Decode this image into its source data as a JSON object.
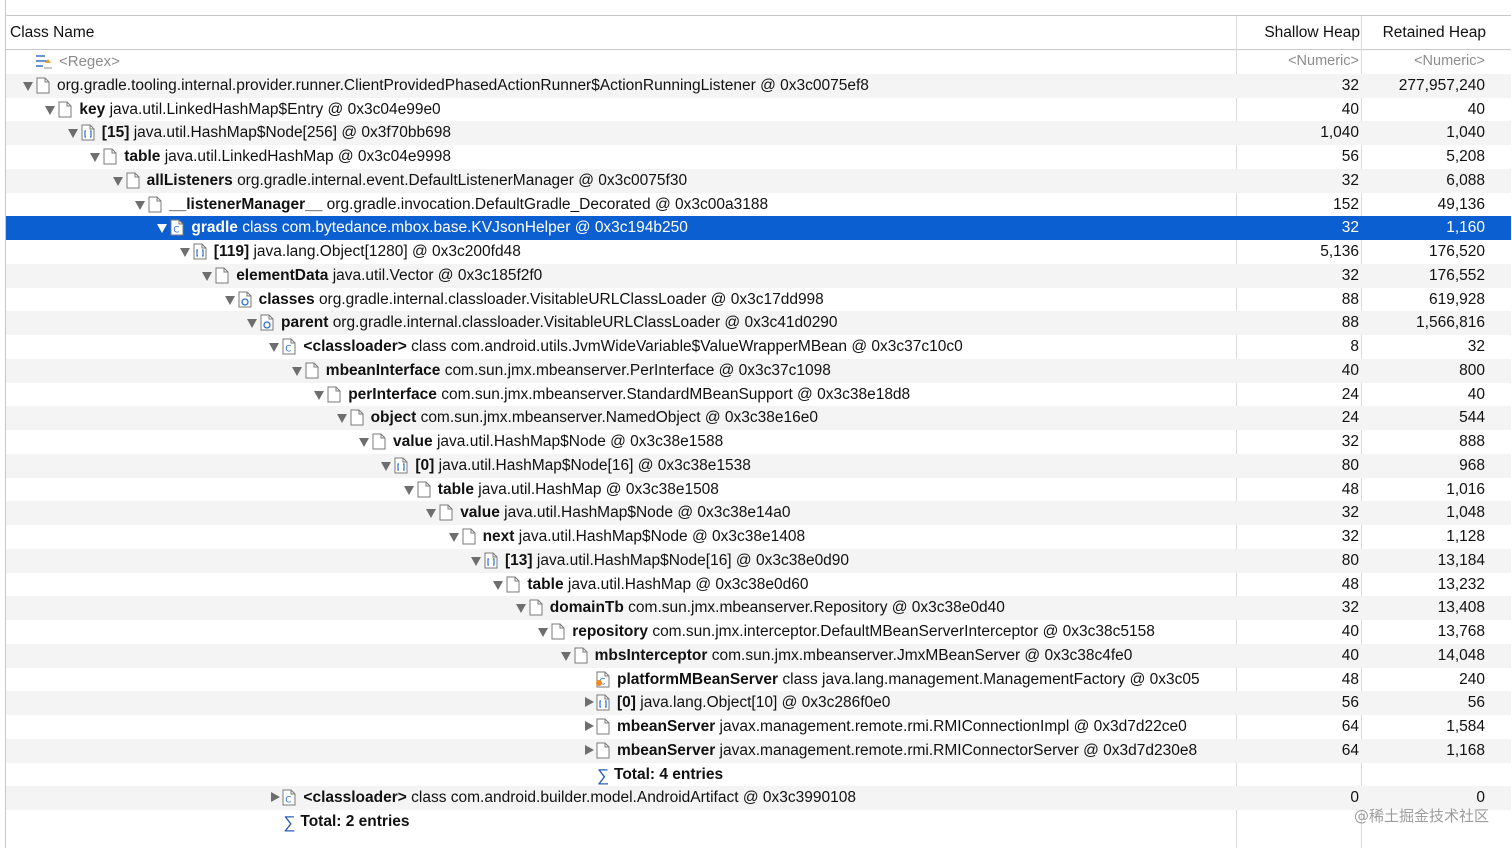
{
  "columns": {
    "class_name": "Class Name",
    "shallow_heap": "Shallow Heap",
    "retained_heap": "Retained Heap"
  },
  "filter": {
    "regex": "<Regex>",
    "shallow_numeric": "<Numeric>",
    "retained_numeric": "<Numeric>"
  },
  "rows": [
    {
      "indent": 0,
      "toggle": "open",
      "icon": "page",
      "bold": "",
      "text": "org.gradle.tooling.internal.provider.runner.ClientProvidedPhasedActionRunner$ActionRunningListener @ 0x3c0075ef8",
      "shallow": "32",
      "retained": "277,957,240"
    },
    {
      "indent": 1,
      "toggle": "open",
      "icon": "page",
      "bold": "key",
      "text": "java.util.LinkedHashMap$Entry @ 0x3c04e99e0",
      "shallow": "40",
      "retained": "40"
    },
    {
      "indent": 2,
      "toggle": "open",
      "icon": "array",
      "bold": "[15]",
      "text": "java.util.HashMap$Node[256] @ 0x3f70bb698",
      "shallow": "1,040",
      "retained": "1,040"
    },
    {
      "indent": 3,
      "toggle": "open",
      "icon": "page",
      "bold": "table",
      "text": "java.util.LinkedHashMap @ 0x3c04e9998",
      "shallow": "56",
      "retained": "5,208"
    },
    {
      "indent": 4,
      "toggle": "open",
      "icon": "page",
      "bold": "allListeners",
      "text": "org.gradle.internal.event.DefaultListenerManager @ 0x3c0075f30",
      "shallow": "32",
      "retained": "6,088"
    },
    {
      "indent": 5,
      "toggle": "open",
      "icon": "page",
      "bold": "__listenerManager__",
      "text": "org.gradle.invocation.DefaultGradle_Decorated @ 0x3c00a3188",
      "shallow": "152",
      "retained": "49,136"
    },
    {
      "indent": 6,
      "toggle": "open",
      "icon": "class",
      "bold": "gradle",
      "text": "class com.bytedance.mbox.base.KVJsonHelper @ 0x3c194b250",
      "shallow": "32",
      "retained": "1,160",
      "selected": true
    },
    {
      "indent": 7,
      "toggle": "open",
      "icon": "array",
      "bold": "[119]",
      "text": "java.lang.Object[1280] @ 0x3c200fd48",
      "shallow": "5,136",
      "retained": "176,520"
    },
    {
      "indent": 8,
      "toggle": "open",
      "icon": "page",
      "bold": "elementData",
      "text": "java.util.Vector @ 0x3c185f2f0",
      "shallow": "32",
      "retained": "176,552"
    },
    {
      "indent": 9,
      "toggle": "open",
      "icon": "loader",
      "bold": "classes",
      "text": "org.gradle.internal.classloader.VisitableURLClassLoader @ 0x3c17dd998",
      "shallow": "88",
      "retained": "619,928"
    },
    {
      "indent": 10,
      "toggle": "open",
      "icon": "loader",
      "bold": "parent",
      "text": "org.gradle.internal.classloader.VisitableURLClassLoader @ 0x3c41d0290",
      "shallow": "88",
      "retained": "1,566,816"
    },
    {
      "indent": 11,
      "toggle": "open",
      "icon": "class",
      "bold": "<classloader>",
      "text": "class com.android.utils.JvmWideVariable$ValueWrapperMBean @ 0x3c37c10c0",
      "shallow": "8",
      "retained": "32"
    },
    {
      "indent": 12,
      "toggle": "open",
      "icon": "page",
      "bold": "mbeanInterface",
      "text": "com.sun.jmx.mbeanserver.PerInterface @ 0x3c37c1098",
      "shallow": "40",
      "retained": "800"
    },
    {
      "indent": 13,
      "toggle": "open",
      "icon": "page",
      "bold": "perInterface",
      "text": "com.sun.jmx.mbeanserver.StandardMBeanSupport @ 0x3c38e18d8",
      "shallow": "24",
      "retained": "40"
    },
    {
      "indent": 14,
      "toggle": "open",
      "icon": "page",
      "bold": "object",
      "text": "com.sun.jmx.mbeanserver.NamedObject @ 0x3c38e16e0",
      "shallow": "24",
      "retained": "544"
    },
    {
      "indent": 15,
      "toggle": "open",
      "icon": "page",
      "bold": "value",
      "text": "java.util.HashMap$Node @ 0x3c38e1588",
      "shallow": "32",
      "retained": "888"
    },
    {
      "indent": 16,
      "toggle": "open",
      "icon": "array",
      "bold": "[0]",
      "text": "java.util.HashMap$Node[16] @ 0x3c38e1538",
      "shallow": "80",
      "retained": "968"
    },
    {
      "indent": 17,
      "toggle": "open",
      "icon": "page",
      "bold": "table",
      "text": "java.util.HashMap @ 0x3c38e1508",
      "shallow": "48",
      "retained": "1,016"
    },
    {
      "indent": 18,
      "toggle": "open",
      "icon": "page",
      "bold": "value",
      "text": "java.util.HashMap$Node @ 0x3c38e14a0",
      "shallow": "32",
      "retained": "1,048"
    },
    {
      "indent": 19,
      "toggle": "open",
      "icon": "page",
      "bold": "next",
      "text": "java.util.HashMap$Node @ 0x3c38e1408",
      "shallow": "32",
      "retained": "1,128"
    },
    {
      "indent": 20,
      "toggle": "open",
      "icon": "array",
      "bold": "[13]",
      "text": "java.util.HashMap$Node[16] @ 0x3c38e0d90",
      "shallow": "80",
      "retained": "13,184"
    },
    {
      "indent": 21,
      "toggle": "open",
      "icon": "page",
      "bold": "table",
      "text": "java.util.HashMap @ 0x3c38e0d60",
      "shallow": "48",
      "retained": "13,232"
    },
    {
      "indent": 22,
      "toggle": "open",
      "icon": "page",
      "bold": "domainTb",
      "text": "com.sun.jmx.mbeanserver.Repository @ 0x3c38e0d40",
      "shallow": "32",
      "retained": "13,408"
    },
    {
      "indent": 23,
      "toggle": "open",
      "icon": "page",
      "bold": "repository",
      "text": "com.sun.jmx.interceptor.DefaultMBeanServerInterceptor @ 0x3c38c5158",
      "shallow": "40",
      "retained": "13,768"
    },
    {
      "indent": 24,
      "toggle": "open",
      "icon": "page",
      "bold": "mbsInterceptor",
      "text": "com.sun.jmx.mbeanserver.JmxMBeanServer @ 0x3c38c4fe0",
      "shallow": "40",
      "retained": "14,048"
    },
    {
      "indent": 25,
      "toggle": "none",
      "icon": "classgc",
      "bold": "platformMBeanServer",
      "text": "class java.lang.management.ManagementFactory @ 0x3c05",
      "shallow": "48",
      "retained": "240"
    },
    {
      "indent": 25,
      "toggle": "closed",
      "icon": "array",
      "bold": "[0]",
      "text": "java.lang.Object[10] @ 0x3c286f0e0",
      "shallow": "56",
      "retained": "56"
    },
    {
      "indent": 25,
      "toggle": "closed",
      "icon": "page",
      "bold": "mbeanServer",
      "text": "javax.management.remote.rmi.RMIConnectionImpl @ 0x3d7d22ce0",
      "shallow": "64",
      "retained": "1,584"
    },
    {
      "indent": 25,
      "toggle": "closed",
      "icon": "page",
      "bold": "mbeanServer",
      "text": "javax.management.remote.rmi.RMIConnectorServer @ 0x3d7d230e8",
      "shallow": "64",
      "retained": "1,168"
    },
    {
      "indent": 25,
      "toggle": "none",
      "icon": "sum",
      "bold": "Total: 4 entries",
      "text": "",
      "shallow": "",
      "retained": ""
    },
    {
      "indent": 11,
      "toggle": "closed",
      "icon": "class",
      "bold": "<classloader>",
      "text": "class com.android.builder.model.AndroidArtifact @ 0x3c3990108",
      "shallow": "0",
      "retained": "0"
    },
    {
      "indent": 11,
      "toggle": "none",
      "icon": "sum",
      "bold": "Total: 2 entries",
      "text": "",
      "shallow": "",
      "retained": ""
    }
  ],
  "watermark": "@稀土掘金技术社区"
}
